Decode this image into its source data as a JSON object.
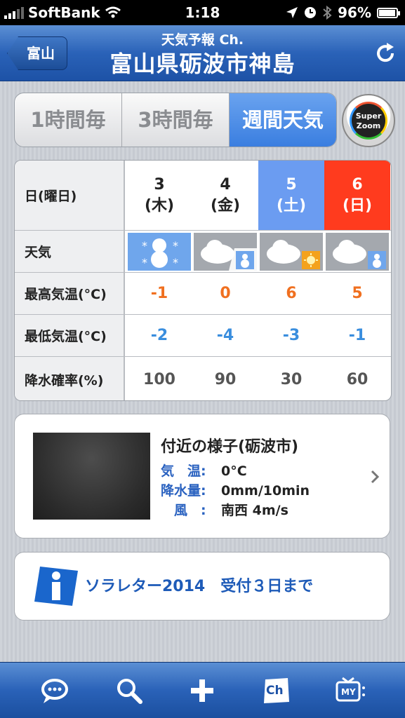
{
  "status_bar": {
    "carrier": "SoftBank",
    "time": "1:18",
    "battery": "96%",
    "battery_fraction": 0.96
  },
  "nav": {
    "back_label": "富山",
    "subtitle": "天気予報 Ch.",
    "title": "富山県砺波市神島",
    "refresh_icon": "refresh-icon"
  },
  "segments": {
    "hourly": "1時間毎",
    "three_hour": "3時間毎",
    "weekly": "週間天気",
    "active": "weekly"
  },
  "super_zoom": {
    "line1": "Super",
    "line2": "Zoom"
  },
  "forecast": {
    "headers": {
      "day": "日(曜日)",
      "weather": "天気",
      "high": "最高気温(°C)",
      "low": "最低気温(°C)",
      "pop": "降水確率(%)"
    },
    "days": [
      {
        "date": "3",
        "dow": "(木)",
        "kind": "weekday",
        "weather": "snow",
        "high": "-1",
        "low": "-2",
        "pop": "100"
      },
      {
        "date": "4",
        "dow": "(金)",
        "kind": "weekday",
        "weather": "cloudy-snow",
        "high": "0",
        "low": "-4",
        "pop": "90"
      },
      {
        "date": "5",
        "dow": "(土)",
        "kind": "saturday",
        "weather": "cloudy-sunny",
        "high": "6",
        "low": "-3",
        "pop": "30"
      },
      {
        "date": "6",
        "dow": "(日)",
        "kind": "sunday",
        "weather": "cloudy-snow",
        "high": "5",
        "low": "-1",
        "pop": "60"
      }
    ],
    "colors": {
      "saturday": "#6b9cf1",
      "sunday": "#ff3b1e",
      "high": "#f07020",
      "low": "#3a8ede"
    }
  },
  "nearby": {
    "title": "付近の様子(砺波市)",
    "temp_label": "気　温:",
    "temp_value": "0°C",
    "precip_label": "降水量:",
    "precip_value": "0mm/10min",
    "wind_label": "　風　:",
    "wind_value": "南西 4m/s"
  },
  "campaign": {
    "text": "ソラレター2014　受付３日まで"
  },
  "tabs": [
    "chat-icon",
    "search-icon",
    "add-icon",
    "channel-icon",
    "my-tv-icon"
  ],
  "tab_labels": {
    "channel": "Ch",
    "my": "MY"
  }
}
